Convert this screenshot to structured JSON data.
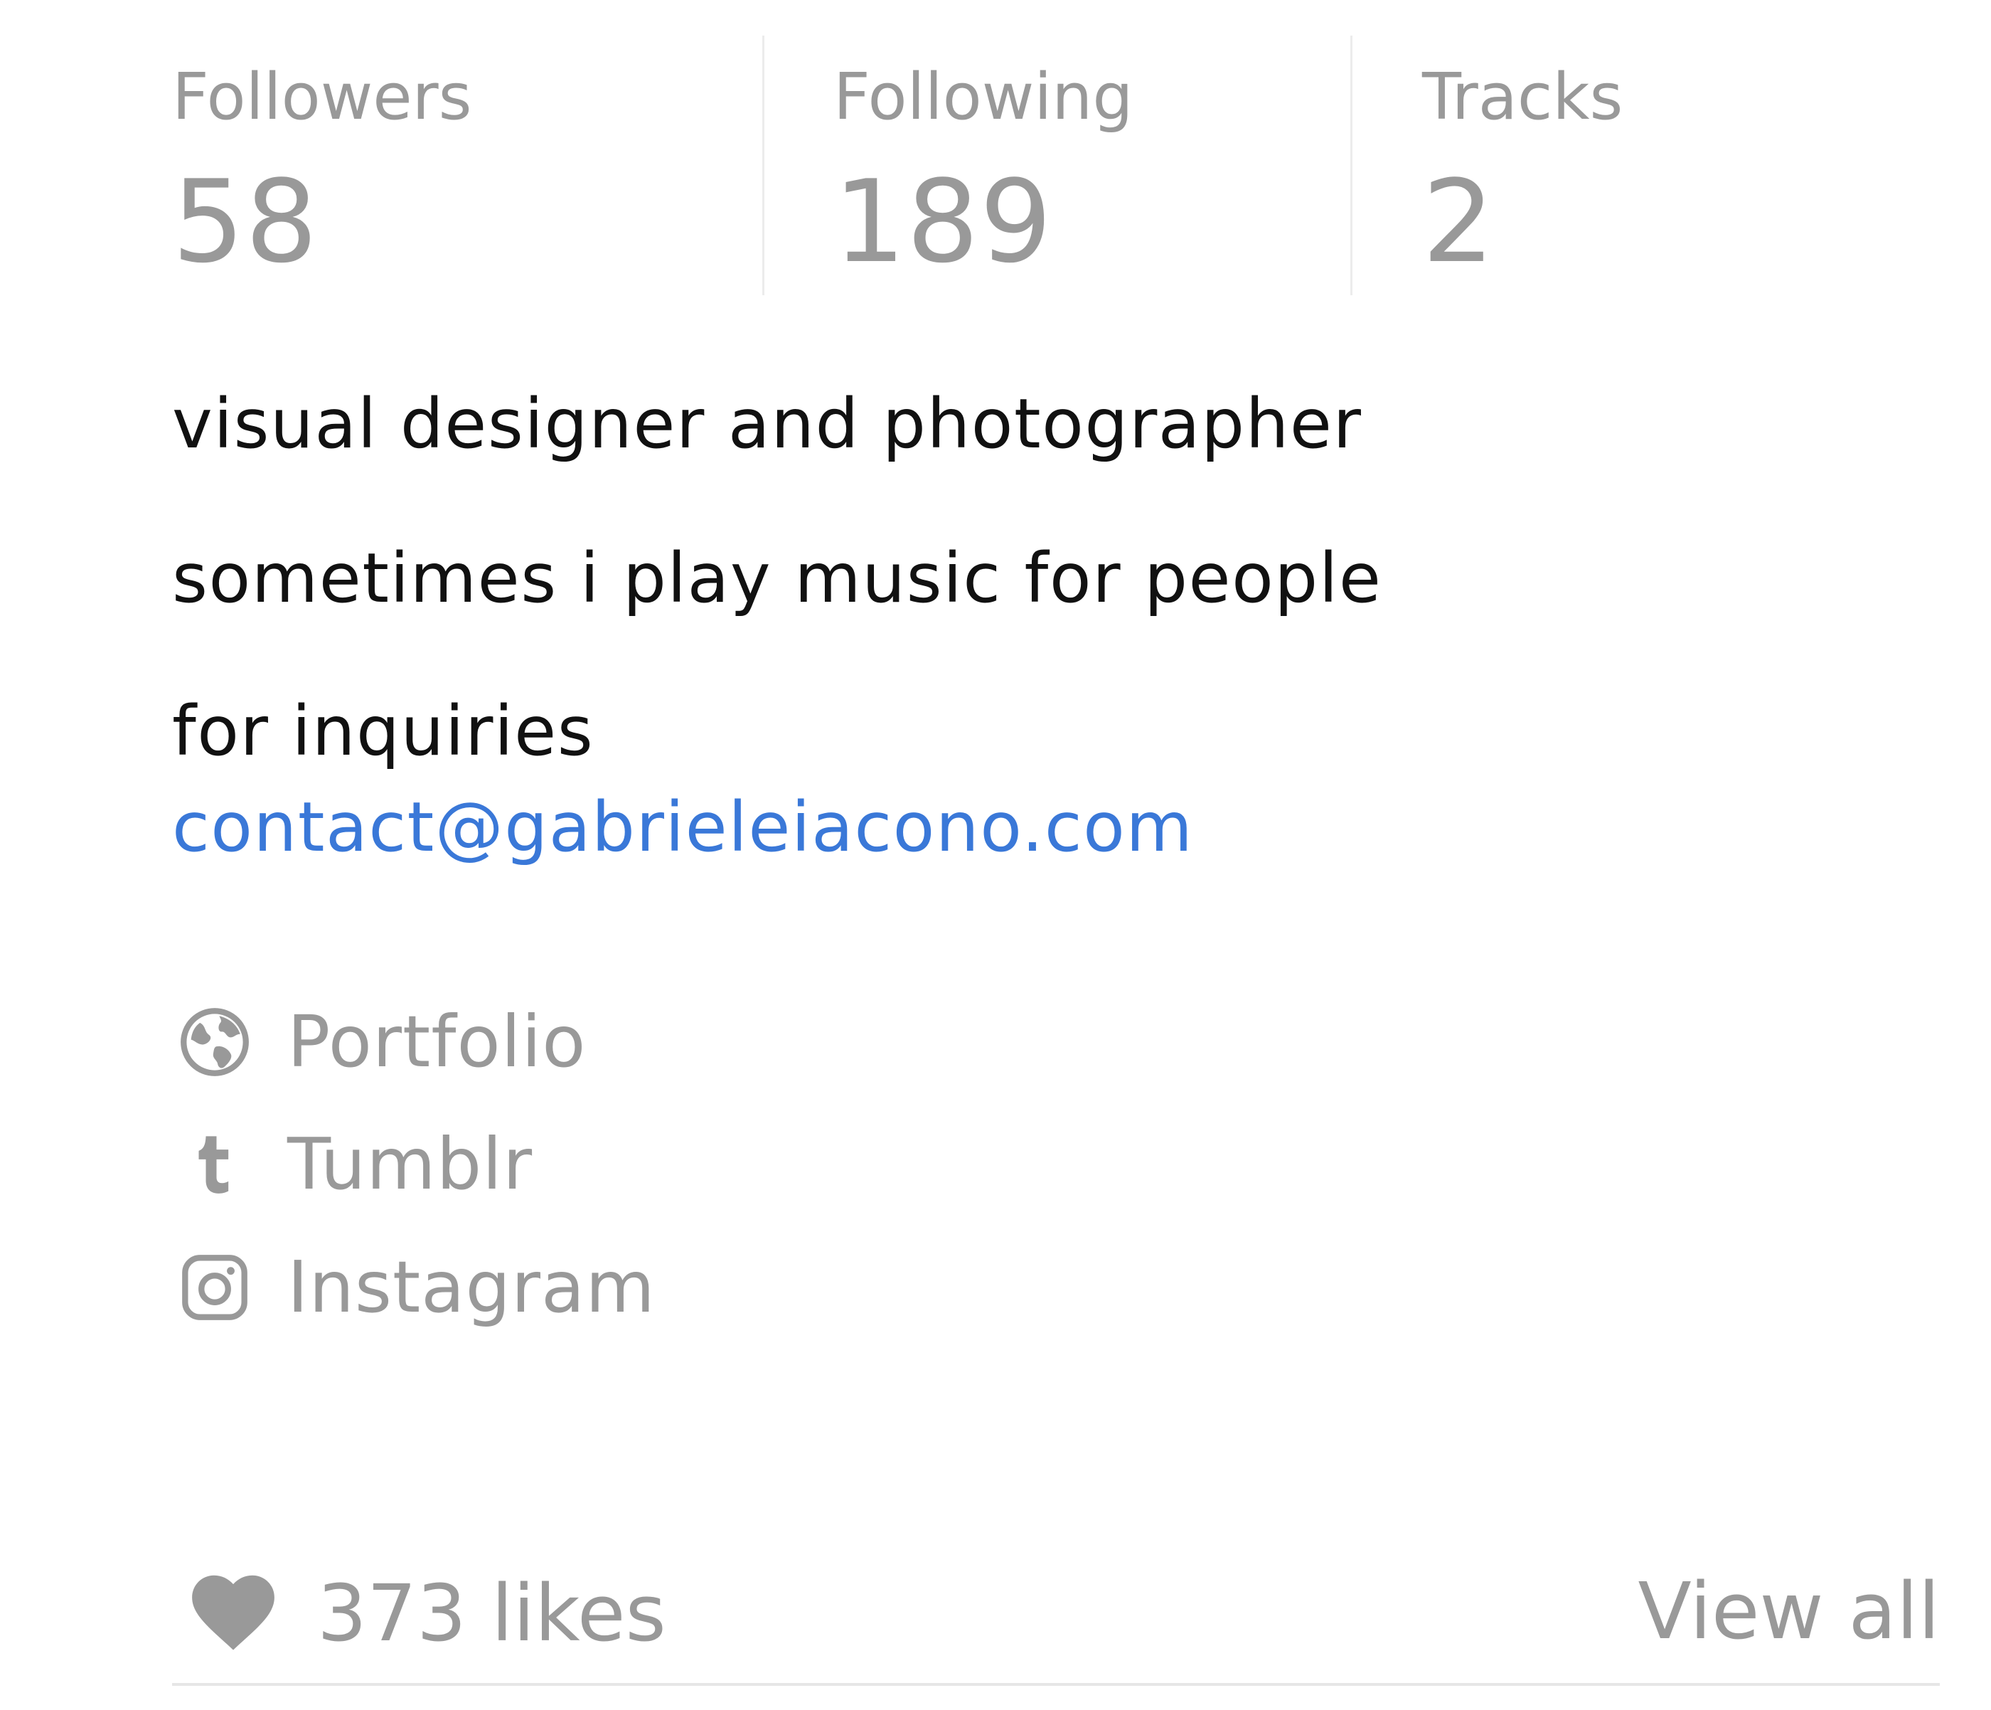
{
  "stats": [
    {
      "label": "Followers",
      "value": "58"
    },
    {
      "label": "Following",
      "value": "189"
    },
    {
      "label": "Tracks",
      "value": "2"
    }
  ],
  "bio": {
    "line1": "visual designer and photographer",
    "line2": "sometimes i play music for people",
    "line3": "for inquiries",
    "email": "contact@gabrieleiacono.com"
  },
  "links": [
    {
      "icon": "globe-icon",
      "label": "Portfolio"
    },
    {
      "icon": "tumblr-icon",
      "label": "Tumblr"
    },
    {
      "icon": "instagram-icon",
      "label": "Instagram"
    }
  ],
  "likes": {
    "icon": "heart-icon",
    "count_label": "373 likes",
    "view_all_label": "View all"
  },
  "colors": {
    "muted": "#999999",
    "text": "#111111",
    "link": "#3a78d8",
    "divider": "#ececec"
  }
}
